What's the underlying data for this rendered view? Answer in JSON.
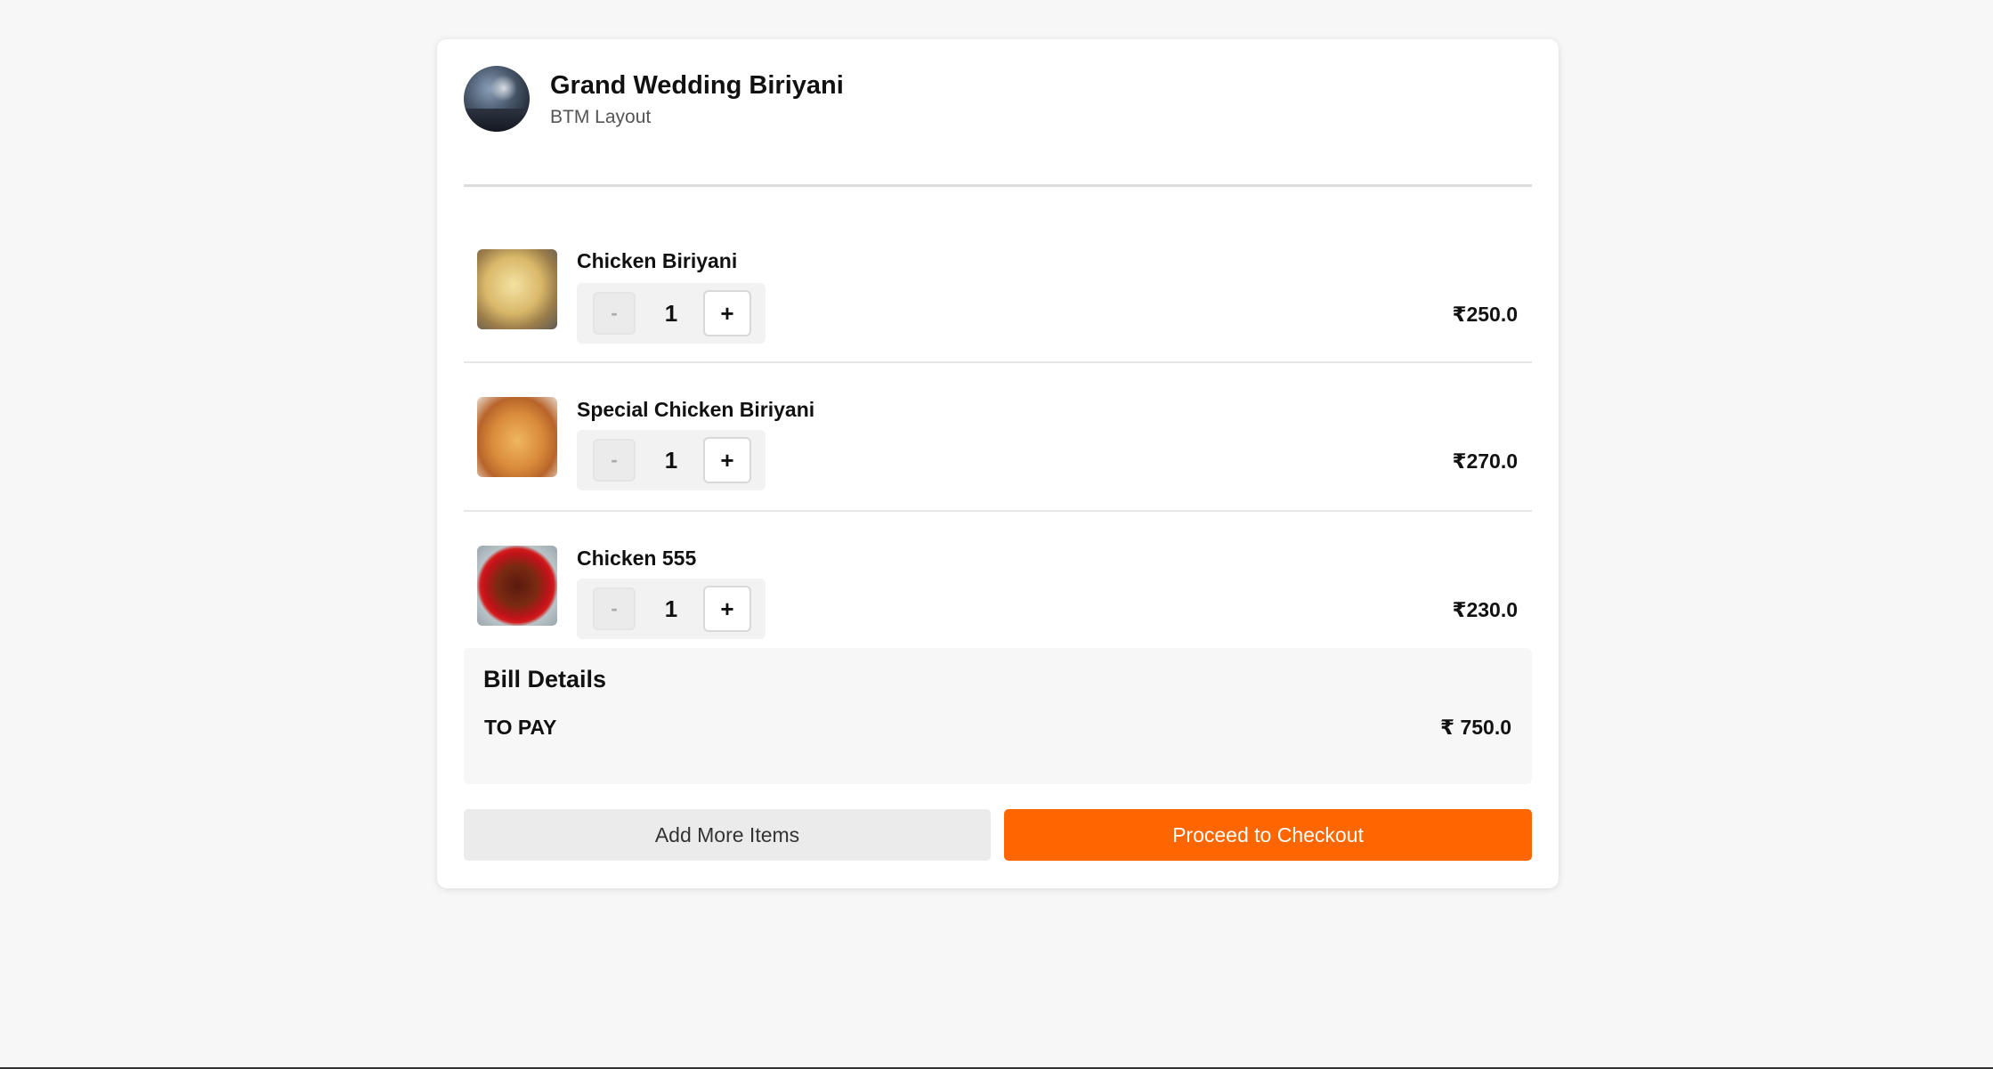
{
  "restaurant": {
    "name": "Grand Wedding Biriyani",
    "area": "BTM Layout"
  },
  "cart": {
    "items": [
      {
        "name": "Chicken Biriyani",
        "quantity": "1",
        "price": "₹250.0",
        "minus_label": "-",
        "plus_label": "+",
        "image": "chicken-biriyani-image"
      },
      {
        "name": "Special Chicken Biriyani",
        "quantity": "1",
        "price": "₹270.0",
        "minus_label": "-",
        "plus_label": "+",
        "image": "special-chicken-biriyani-image"
      },
      {
        "name": "Chicken 555",
        "quantity": "1",
        "price": "₹230.0",
        "minus_label": "-",
        "plus_label": "+",
        "image": "chicken-555-image"
      }
    ]
  },
  "bill": {
    "title": "Bill Details",
    "to_pay_label": "TO PAY",
    "to_pay_value": "₹ 750.0"
  },
  "actions": {
    "add_more_label": "Add More Items",
    "checkout_label": "Proceed to Checkout"
  },
  "colors": {
    "accent": "#ff6600",
    "background": "#f7f7f7",
    "card": "#ffffff"
  }
}
